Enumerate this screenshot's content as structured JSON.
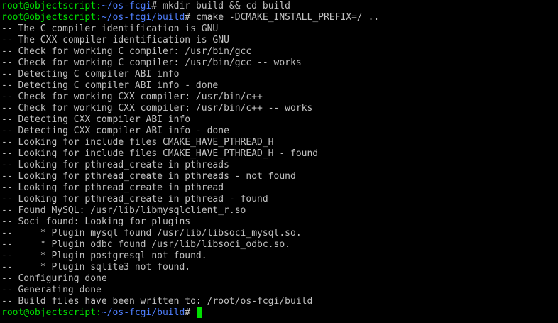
{
  "colors": {
    "background": "#000000",
    "text": "#c0c0c0",
    "prompt_user": "#00e000",
    "prompt_path": "#4f7fff",
    "cursor": "#00e000"
  },
  "lines": [
    {
      "type": "prompt",
      "user": "root@objectscript",
      "sep": ":",
      "path": "~/os-fcgi",
      "end": "# ",
      "command": "mkdir build && cd build"
    },
    {
      "type": "prompt",
      "user": "root@objectscript",
      "sep": ":",
      "path": "~/os-fcgi/build",
      "end": "# ",
      "command": "cmake -DCMAKE_INSTALL_PREFIX=/ .."
    },
    {
      "type": "output",
      "text": "-- The C compiler identification is GNU"
    },
    {
      "type": "output",
      "text": "-- The CXX compiler identification is GNU"
    },
    {
      "type": "output",
      "text": "-- Check for working C compiler: /usr/bin/gcc"
    },
    {
      "type": "output",
      "text": "-- Check for working C compiler: /usr/bin/gcc -- works"
    },
    {
      "type": "output",
      "text": "-- Detecting C compiler ABI info"
    },
    {
      "type": "output",
      "text": "-- Detecting C compiler ABI info - done"
    },
    {
      "type": "output",
      "text": "-- Check for working CXX compiler: /usr/bin/c++"
    },
    {
      "type": "output",
      "text": "-- Check for working CXX compiler: /usr/bin/c++ -- works"
    },
    {
      "type": "output",
      "text": "-- Detecting CXX compiler ABI info"
    },
    {
      "type": "output",
      "text": "-- Detecting CXX compiler ABI info - done"
    },
    {
      "type": "output",
      "text": "-- Looking for include files CMAKE_HAVE_PTHREAD_H"
    },
    {
      "type": "output",
      "text": "-- Looking for include files CMAKE_HAVE_PTHREAD_H - found"
    },
    {
      "type": "output",
      "text": "-- Looking for pthread_create in pthreads"
    },
    {
      "type": "output",
      "text": "-- Looking for pthread_create in pthreads - not found"
    },
    {
      "type": "output",
      "text": "-- Looking for pthread_create in pthread"
    },
    {
      "type": "output",
      "text": "-- Looking for pthread_create in pthread - found"
    },
    {
      "type": "output",
      "text": "-- Found MySQL: /usr/lib/libmysqlclient_r.so"
    },
    {
      "type": "output",
      "text": "-- Soci found: Looking for plugins"
    },
    {
      "type": "output",
      "text": "--     * Plugin mysql found /usr/lib/libsoci_mysql.so."
    },
    {
      "type": "output",
      "text": "--     * Plugin odbc found /usr/lib/libsoci_odbc.so."
    },
    {
      "type": "output",
      "text": "--     * Plugin postgresql not found."
    },
    {
      "type": "output",
      "text": "--     * Plugin sqlite3 not found."
    },
    {
      "type": "output",
      "text": "-- Configuring done"
    },
    {
      "type": "output",
      "text": "-- Generating done"
    },
    {
      "type": "output",
      "text": "-- Build files have been written to: /root/os-fcgi/build"
    },
    {
      "type": "prompt",
      "user": "root@objectscript",
      "sep": ":",
      "path": "~/os-fcgi/build",
      "end": "# ",
      "command": "",
      "cursor": true
    }
  ]
}
